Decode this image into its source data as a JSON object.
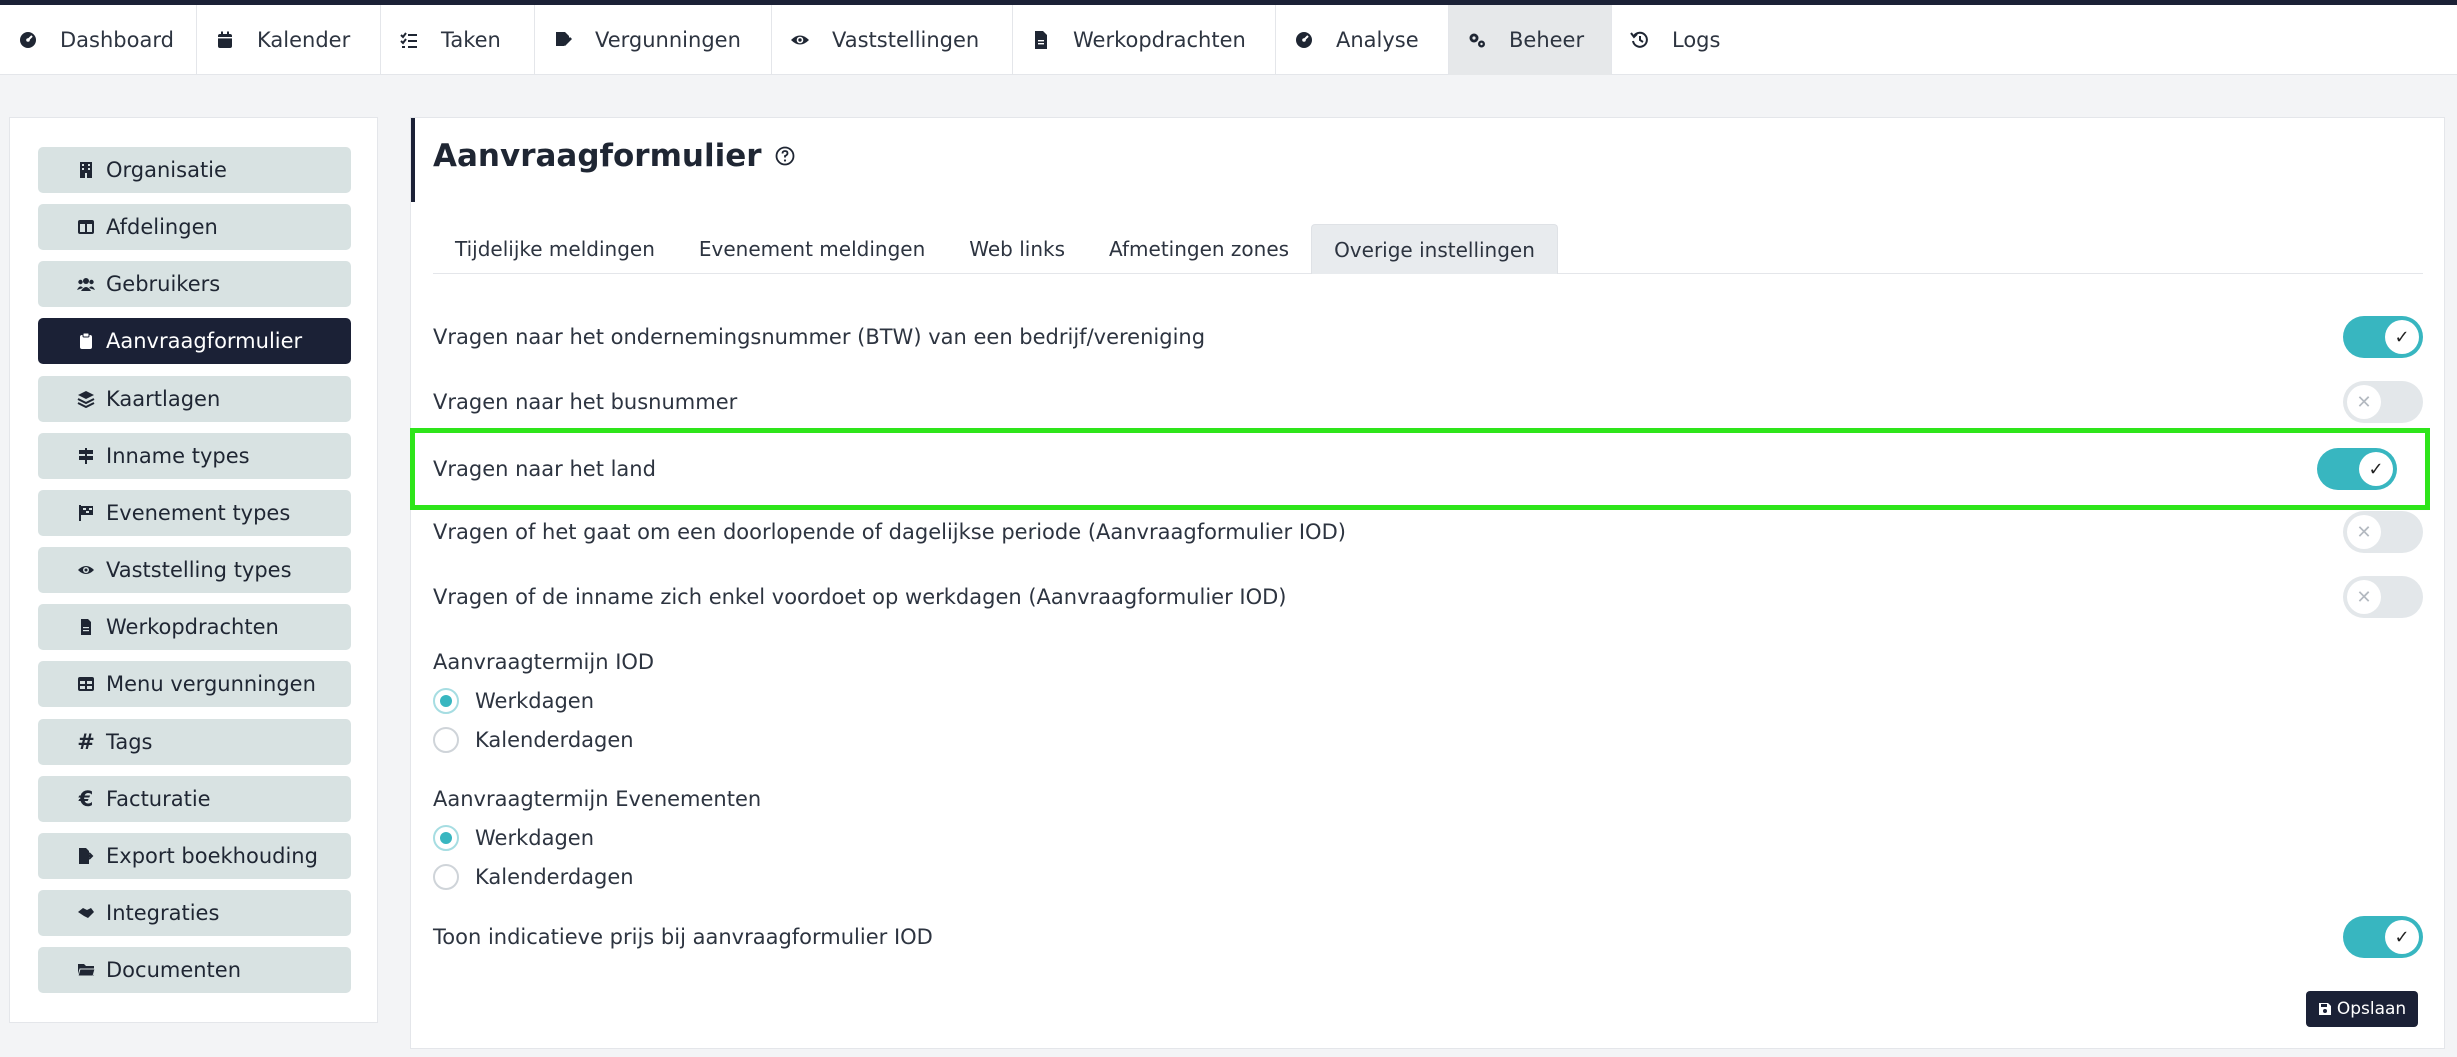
{
  "nav": {
    "items": [
      {
        "label": "Dashboard",
        "icon": "gauge-icon"
      },
      {
        "label": "Kalender",
        "icon": "calendar-icon"
      },
      {
        "label": "Taken",
        "icon": "tasks-icon"
      },
      {
        "label": "Vergunningen",
        "icon": "signature-icon"
      },
      {
        "label": "Vaststellingen",
        "icon": "eye-icon"
      },
      {
        "label": "Werkopdrachten",
        "icon": "file-icon"
      },
      {
        "label": "Analyse",
        "icon": "gauge-icon"
      },
      {
        "label": "Beheer",
        "icon": "gears-icon"
      },
      {
        "label": "Logs",
        "icon": "history-icon"
      }
    ],
    "active": "Beheer"
  },
  "sidebar": {
    "items": [
      {
        "label": "Organisatie",
        "icon": "building-icon"
      },
      {
        "label": "Afdelingen",
        "icon": "table-icon"
      },
      {
        "label": "Gebruikers",
        "icon": "users-icon"
      },
      {
        "label": "Aanvraagformulier",
        "icon": "clipboard-icon"
      },
      {
        "label": "Kaartlagen",
        "icon": "layers-icon"
      },
      {
        "label": "Inname types",
        "icon": "signs-icon"
      },
      {
        "label": "Evenement types",
        "icon": "flag-icon"
      },
      {
        "label": "Vaststelling types",
        "icon": "eye-icon"
      },
      {
        "label": "Werkopdrachten",
        "icon": "file-icon"
      },
      {
        "label": "Menu vergunningen",
        "icon": "table-icon"
      },
      {
        "label": "Tags",
        "icon": "hashtag-icon"
      },
      {
        "label": "Facturatie",
        "icon": "euro-icon"
      },
      {
        "label": "Export boekhouding",
        "icon": "file-export-icon"
      },
      {
        "label": "Integraties",
        "icon": "handshake-icon"
      },
      {
        "label": "Documenten",
        "icon": "folder-icon"
      }
    ],
    "active": "Aanvraagformulier"
  },
  "main": {
    "title": "Aanvraagformulier",
    "tabs": [
      {
        "label": "Tijdelijke meldingen"
      },
      {
        "label": "Evenement meldingen"
      },
      {
        "label": "Web links"
      },
      {
        "label": "Afmetingen zones"
      },
      {
        "label": "Overige instellingen"
      }
    ],
    "active_tab": "Overige instellingen",
    "settings": [
      {
        "label": "Vragen naar het ondernemingsnummer (BTW) van een bedrijf/vereniging",
        "enabled": true
      },
      {
        "label": "Vragen naar het busnummer",
        "enabled": false
      },
      {
        "label": "Vragen naar het land",
        "enabled": true
      },
      {
        "label": "Vragen of het gaat om een doorlopende of dagelijkse periode (Aanvraagformulier IOD)",
        "enabled": false
      },
      {
        "label": "Vragen of de inname zich enkel voordoet op werkdagen (Aanvraagformulier IOD)",
        "enabled": false
      }
    ],
    "term_iod": {
      "label": "Aanvraagtermijn IOD",
      "options": [
        "Werkdagen",
        "Kalenderdagen"
      ],
      "selected": "Werkdagen"
    },
    "term_events": {
      "label": "Aanvraagtermijn Evenementen",
      "options": [
        "Werkdagen",
        "Kalenderdagen"
      ],
      "selected": "Werkdagen"
    },
    "price_setting": {
      "label": "Toon indicatieve prijs bij aanvraagformulier IOD",
      "enabled": true
    },
    "save_label": "Opslaan"
  },
  "colors": {
    "accent": "#38b6c0",
    "dark": "#1b2136",
    "highlight": "#2ee51a",
    "sidebar_item_bg": "#d8e2e2"
  }
}
